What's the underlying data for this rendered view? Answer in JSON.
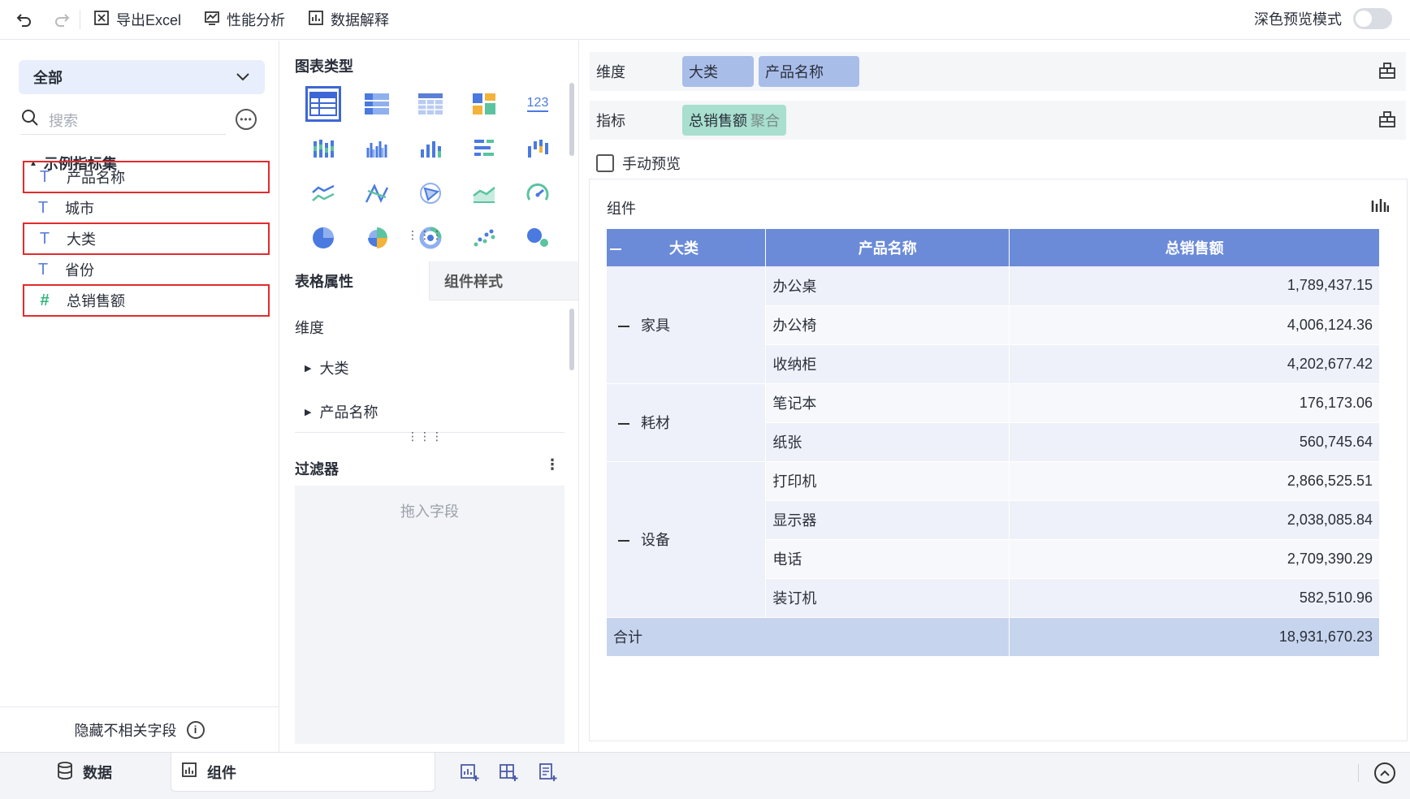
{
  "toolbar": {
    "undo_icon": "undo-icon",
    "redo_icon": "redo-icon",
    "export_label": "导出Excel",
    "perf_label": "性能分析",
    "explain_label": "数据解释",
    "dark_mode_label": "深色预览模式",
    "dark_mode_on": false
  },
  "left": {
    "dataset_select": "全部",
    "search_placeholder": "搜索",
    "group_title": "示例指标集",
    "fields": [
      {
        "label": "产品名称",
        "type": "text"
      },
      {
        "label": "城市",
        "type": "text"
      },
      {
        "label": "大类",
        "type": "text"
      },
      {
        "label": "省份",
        "type": "text"
      },
      {
        "label": "总销售额",
        "type": "number"
      }
    ],
    "hide_unrelated": "隐藏不相关字段"
  },
  "middle": {
    "chart_types_title": "图表类型",
    "tab_table_props": "表格属性",
    "tab_component_style": "组件样式",
    "dimension_label": "维度",
    "dimension_items": [
      "大类",
      "产品名称"
    ],
    "filter_title": "过滤器",
    "filter_drop_hint": "拖入字段"
  },
  "right": {
    "dimension_label": "维度",
    "dimension_pills": [
      "大类",
      "产品名称"
    ],
    "metric_label": "指标",
    "metric_pill": "总销售额",
    "metric_agg": "聚合",
    "manual_preview": "手动预览",
    "component_title": "组件",
    "table": {
      "headers": [
        "大类",
        "产品名称",
        "总销售额"
      ],
      "groups": [
        {
          "category": "家具",
          "rows": [
            {
              "product": "办公桌",
              "value": "1,789,437.15"
            },
            {
              "product": "办公椅",
              "value": "4,006,124.36"
            },
            {
              "product": "收纳柜",
              "value": "4,202,677.42"
            }
          ]
        },
        {
          "category": "耗材",
          "rows": [
            {
              "product": "笔记本",
              "value": "176,173.06"
            },
            {
              "product": "纸张",
              "value": "560,745.64"
            }
          ]
        },
        {
          "category": "设备",
          "rows": [
            {
              "product": "打印机",
              "value": "2,866,525.51"
            },
            {
              "product": "显示器",
              "value": "2,038,085.84"
            },
            {
              "product": "电话",
              "value": "2,709,390.29"
            },
            {
              "product": "装订机",
              "value": "582,510.96"
            }
          ]
        }
      ],
      "total_label": "合计",
      "total_value": "18,931,670.23"
    }
  },
  "bottom": {
    "tab_data": "数据",
    "tab_component": "组件"
  },
  "colors": {
    "accent": "#6b8bd8",
    "pill_blue": "#a9bde9",
    "pill_green": "#a8dfcf",
    "highlight_border": "#e32b2b"
  }
}
